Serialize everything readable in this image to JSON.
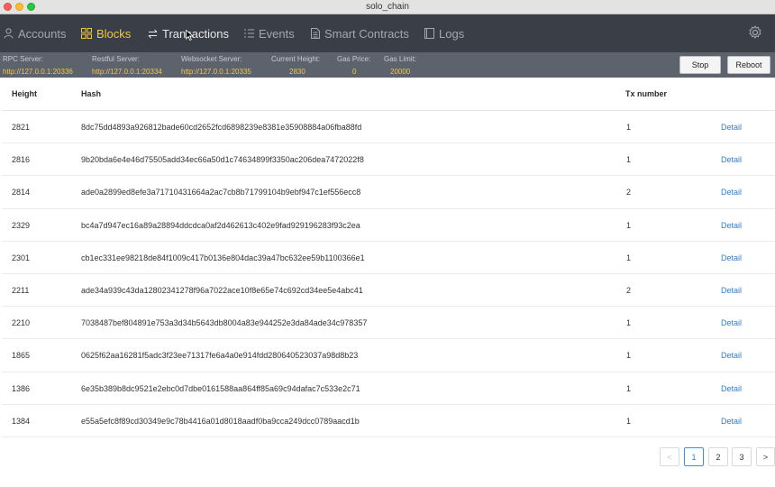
{
  "window": {
    "title": "solo_chain"
  },
  "nav": {
    "items": [
      {
        "label": "Accounts"
      },
      {
        "label": "Blocks"
      },
      {
        "label": "Transactions"
      },
      {
        "label": "Events"
      },
      {
        "label": "Smart Contracts"
      },
      {
        "label": "Logs"
      }
    ],
    "active": "Blocks"
  },
  "info": {
    "rpc": {
      "label": "RPC Server:",
      "value": "http://127.0.0.1:20336"
    },
    "rest": {
      "label": "Restful Server:",
      "value": "http://127.0.0.1:20334"
    },
    "ws": {
      "label": "Websocket Server:",
      "value": "http://127.0.0.1:20335"
    },
    "height": {
      "label": "Current Height:",
      "value": "2830"
    },
    "gas_price": {
      "label": "Gas Price:",
      "value": "0"
    },
    "gas_limit": {
      "label": "Gas Limit:",
      "value": "20000"
    },
    "stop_label": "Stop",
    "reboot_label": "Reboot"
  },
  "table": {
    "headers": {
      "height": "Height",
      "hash": "Hash",
      "tx": "Tx number"
    },
    "rows": [
      {
        "height": "2821",
        "hash": "8dc75dd4893a926812bade60cd2652fcd6898239e8381e35908884a06fba88fd",
        "tx": "1",
        "action": "Detail"
      },
      {
        "height": "2816",
        "hash": "9b20bda6e4e46d75505add34ec66a50d1c74634899f3350ac206dea7472022f8",
        "tx": "1",
        "action": "Detail"
      },
      {
        "height": "2814",
        "hash": "ade0a2899ed8efe3a71710431664a2ac7cb8b71799104b9ebf947c1ef556ecc8",
        "tx": "2",
        "action": "Detail"
      },
      {
        "height": "2329",
        "hash": "bc4a7d947ec16a89a28894ddcdca0af2d462613c402e9fad929196283f93c2ea",
        "tx": "1",
        "action": "Detail"
      },
      {
        "height": "2301",
        "hash": "cb1ec331ee98218de84f1009c417b0136e804dac39a47bc632ee59b1100366e1",
        "tx": "1",
        "action": "Detail"
      },
      {
        "height": "2211",
        "hash": "ade34a939c43da12802341278f96a7022ace10f8e65e74c692cd34ee5e4abc41",
        "tx": "2",
        "action": "Detail"
      },
      {
        "height": "2210",
        "hash": "7038487bef804891e753a3d34b5643db8004a83e944252e3da84ade34c978357",
        "tx": "1",
        "action": "Detail"
      },
      {
        "height": "1865",
        "hash": "0625f62aa16281f5adc3f23ee71317fe6a4a0e914fdd280640523037a98d8b23",
        "tx": "1",
        "action": "Detail"
      },
      {
        "height": "1386",
        "hash": "6e35b389b8dc9521e2ebc0d7dbe0161588aa864ff85a69c94dafac7c533e2c71",
        "tx": "1",
        "action": "Detail"
      },
      {
        "height": "1384",
        "hash": "e55a5efc8f89cd30349e9c78b4416a01d8018aadf0ba9cca249dcc0789aacd1b",
        "tx": "1",
        "action": "Detail"
      }
    ]
  },
  "pagination": {
    "prev": "<",
    "pages": [
      "1",
      "2",
      "3"
    ],
    "current": "1",
    "next": ">"
  },
  "colors": {
    "nav_bg": "#3a3f47",
    "active": "#f0c844",
    "link": "#2f80d1"
  },
  "icons": [
    "user-icon",
    "blocks-icon",
    "transfer-icon",
    "list-icon",
    "document-icon",
    "logs-icon",
    "gear-icon"
  ]
}
